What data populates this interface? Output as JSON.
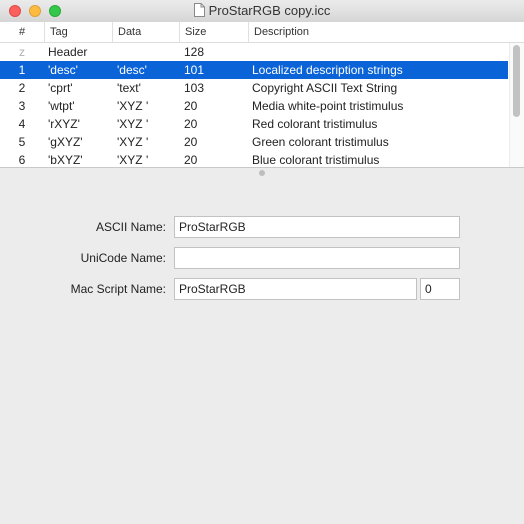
{
  "window": {
    "title": "ProStarRGB copy.icc"
  },
  "table": {
    "columns": [
      "#",
      "Tag",
      "Data",
      "Size",
      "Description"
    ],
    "rows": [
      {
        "num": "z",
        "tag": "Header",
        "data": "",
        "size": "128",
        "desc": ""
      },
      {
        "num": "1",
        "tag": "'desc'",
        "data": "'desc'",
        "size": "101",
        "desc": "Localized description strings"
      },
      {
        "num": "2",
        "tag": "'cprt'",
        "data": "'text'",
        "size": "103",
        "desc": "Copyright ASCII Text String"
      },
      {
        "num": "3",
        "tag": "'wtpt'",
        "data": "'XYZ '",
        "size": "20",
        "desc": "Media white-point tristimulus"
      },
      {
        "num": "4",
        "tag": "'rXYZ'",
        "data": "'XYZ '",
        "size": "20",
        "desc": "Red colorant tristimulus"
      },
      {
        "num": "5",
        "tag": "'gXYZ'",
        "data": "'XYZ '",
        "size": "20",
        "desc": "Green colorant tristimulus"
      },
      {
        "num": "6",
        "tag": "'bXYZ'",
        "data": "'XYZ '",
        "size": "20",
        "desc": "Blue colorant tristimulus"
      }
    ],
    "selected_row": 1
  },
  "form": {
    "ascii_label": "ASCII Name:",
    "ascii_value": "ProStarRGB",
    "unicode_label": "UniCode Name:",
    "unicode_value": "",
    "mac_label": "Mac Script Name:",
    "mac_value": "ProStarRGB",
    "mac_code": "0"
  },
  "colors": {
    "selection": "#0a63d7",
    "close": "#fc605c",
    "minimize": "#fdbc40",
    "zoom": "#34c84a"
  }
}
